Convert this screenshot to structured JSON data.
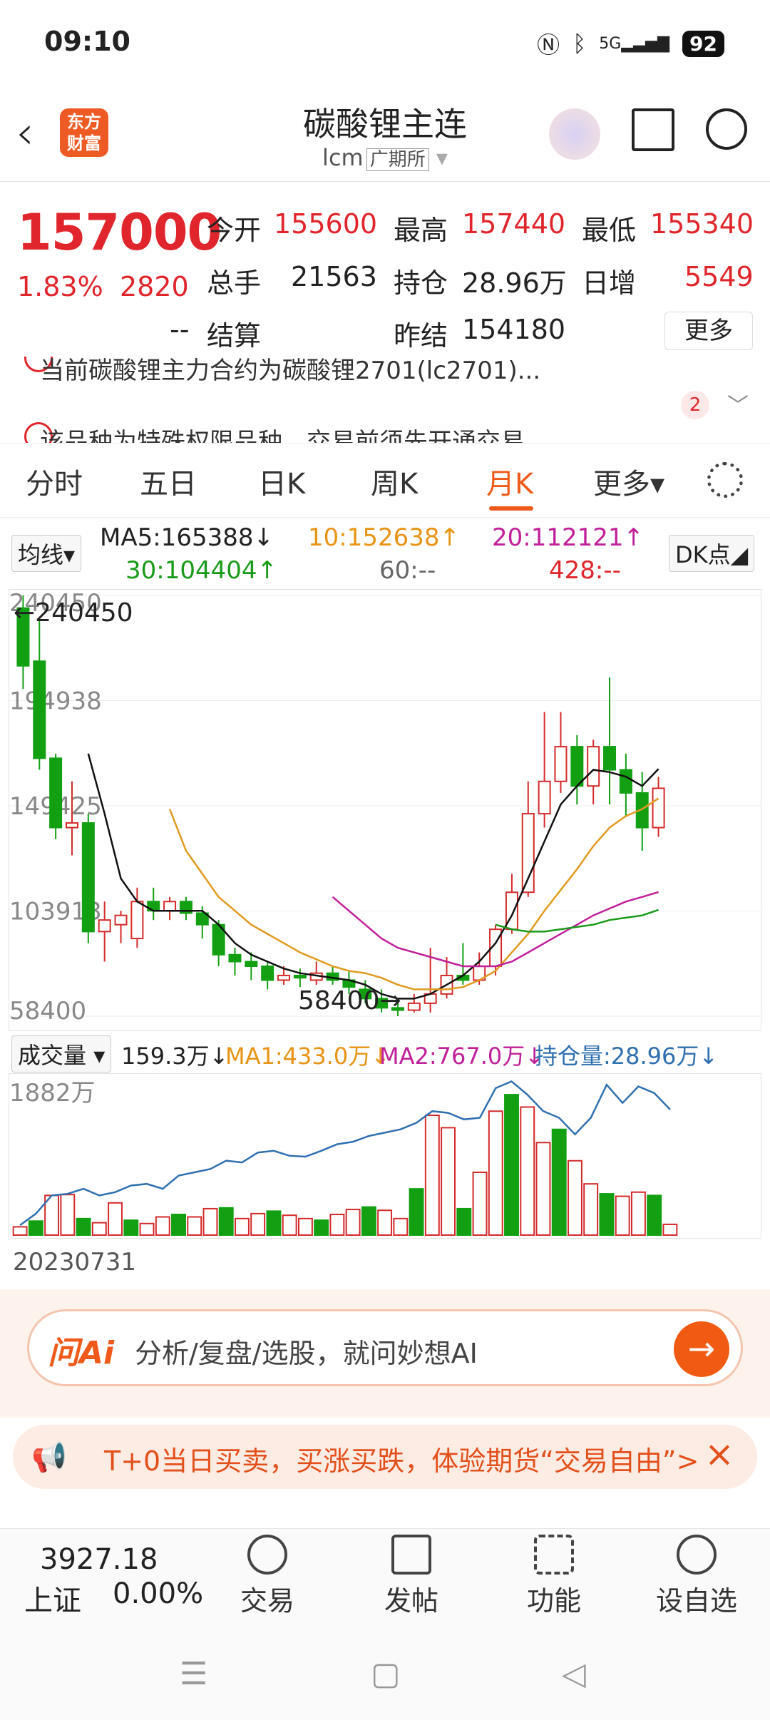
{
  "status": {
    "time": "09:10",
    "network": "5G",
    "battery": "92"
  },
  "header": {
    "logo": "东方\n财富",
    "title": "碳酸锂主连",
    "code": "lcm",
    "exchange": "广期所"
  },
  "quote": {
    "price": "157000",
    "pct": "1.83%",
    "chg": "2820",
    "rows": [
      [
        {
          "k": "今开",
          "v": "155600",
          "c": "red"
        },
        {
          "k": "最高",
          "v": "157440",
          "c": "red"
        },
        {
          "k": "最低",
          "v": "155340",
          "c": "red"
        }
      ],
      [
        {
          "k": "总手",
          "v": "21563",
          "c": "dk"
        },
        {
          "k": "持仓",
          "v": "28.96万",
          "c": "dk"
        },
        {
          "k": "日增",
          "v": "5549",
          "c": "red"
        }
      ],
      [
        {
          "k": "结算",
          "v": "--",
          "c": "dk"
        },
        {
          "k": "昨结",
          "v": "154180",
          "c": "dk"
        }
      ]
    ],
    "more": "更多"
  },
  "notice": {
    "line1": "当前碳酸锂主力合约为碳酸锂2701(lc2701)...",
    "line2": "该品种为特殊权限品种，交易前须先开通交易",
    "count": "2"
  },
  "tabs": [
    "分时",
    "五日",
    "日K",
    "周K",
    "月K",
    "更多▾"
  ],
  "ma": {
    "selector": "均线",
    "ma5": "MA5:165388↓",
    "ma10": "10:152638↑",
    "ma20": "20:112121↑",
    "ma30": "30:104404↑",
    "ma60": "60:--",
    "ma428": "428:--",
    "dk": "DK点"
  },
  "chart_data": {
    "type": "candlestick",
    "y_ticks": [
      "240450",
      "194938",
      "149425",
      "103913",
      "58400"
    ],
    "ylim": [
      58400,
      240450
    ],
    "high_label": "240450",
    "low_label": "58400",
    "candles": [
      [
        235000,
        210000,
        240450,
        200000
      ],
      [
        212000,
        170000,
        230000,
        165000
      ],
      [
        170000,
        140000,
        172000,
        135000
      ],
      [
        140000,
        142000,
        160000,
        128000
      ],
      [
        142000,
        95000,
        146000,
        90000
      ],
      [
        95000,
        100000,
        108000,
        82000
      ],
      [
        98000,
        102000,
        104000,
        90000
      ],
      [
        92000,
        108000,
        114000,
        88000
      ],
      [
        108000,
        104000,
        114000,
        100000
      ],
      [
        104000,
        108000,
        110000,
        100000
      ],
      [
        108000,
        103000,
        110000,
        100000
      ],
      [
        103000,
        98000,
        106000,
        92000
      ],
      [
        98000,
        85000,
        100000,
        80000
      ],
      [
        85000,
        82000,
        88000,
        76000
      ],
      [
        82000,
        80000,
        86000,
        74000
      ],
      [
        80000,
        74000,
        82000,
        70000
      ],
      [
        74000,
        76000,
        80000,
        72000
      ],
      [
        76000,
        75000,
        79000,
        71000
      ],
      [
        74000,
        77000,
        82000,
        72000
      ],
      [
        77000,
        74000,
        80000,
        72000
      ],
      [
        74000,
        71000,
        78000,
        68000
      ],
      [
        70000,
        66000,
        74000,
        64000
      ],
      [
        66000,
        62000,
        70000,
        60000
      ],
      [
        62000,
        61000,
        66000,
        58400
      ],
      [
        61000,
        64000,
        68000,
        60000
      ],
      [
        64000,
        68000,
        88000,
        60000
      ],
      [
        68000,
        76000,
        84000,
        66000
      ],
      [
        76000,
        74000,
        90000,
        72000
      ],
      [
        74000,
        80000,
        86000,
        72000
      ],
      [
        80000,
        96000,
        98000,
        76000
      ],
      [
        96000,
        112000,
        120000,
        94000
      ],
      [
        112000,
        146000,
        160000,
        110000
      ],
      [
        146000,
        160000,
        190000,
        140000
      ],
      [
        160000,
        175000,
        190000,
        155000
      ],
      [
        175000,
        158000,
        180000,
        150000
      ],
      [
        158000,
        175000,
        178000,
        150000
      ],
      [
        175000,
        165000,
        205000,
        150000
      ],
      [
        165000,
        155000,
        172000,
        145000
      ],
      [
        155000,
        140000,
        164000,
        130000
      ],
      [
        140000,
        157000,
        162000,
        136000
      ]
    ],
    "ma5": [
      null,
      null,
      null,
      null,
      172000,
      146000,
      118000,
      108000,
      104000,
      104000,
      104000,
      104000,
      98000,
      90000,
      85000,
      82000,
      79000,
      77000,
      76000,
      75000,
      74000,
      72000,
      68000,
      66000,
      66000,
      68000,
      72000,
      76000,
      82000,
      90000,
      102000,
      118000,
      134000,
      150000,
      158000,
      165000,
      164000,
      162000,
      158000,
      165388
    ],
    "ma10": [
      null,
      null,
      null,
      null,
      null,
      null,
      null,
      null,
      null,
      148000,
      130000,
      120000,
      110000,
      104000,
      98000,
      94000,
      90000,
      86000,
      83000,
      80000,
      78000,
      77000,
      75000,
      72000,
      70000,
      70000,
      70000,
      71000,
      74000,
      78000,
      86000,
      94000,
      104000,
      113000,
      122000,
      132000,
      140000,
      145000,
      148000,
      152638
    ],
    "ma20": [
      null,
      null,
      null,
      null,
      null,
      null,
      null,
      null,
      null,
      null,
      null,
      null,
      null,
      null,
      null,
      null,
      null,
      null,
      null,
      110000,
      104000,
      98000,
      92000,
      88000,
      86000,
      84000,
      82000,
      80000,
      80000,
      80000,
      82000,
      86000,
      90000,
      94000,
      98000,
      102000,
      105000,
      108000,
      110000,
      112121
    ],
    "ma30": [
      null,
      null,
      null,
      null,
      null,
      null,
      null,
      null,
      null,
      null,
      null,
      null,
      null,
      null,
      null,
      null,
      null,
      null,
      null,
      null,
      null,
      null,
      null,
      null,
      null,
      null,
      null,
      null,
      null,
      98000,
      96000,
      95000,
      95000,
      96000,
      97000,
      98000,
      100000,
      101000,
      102000,
      104404
    ]
  },
  "vol": {
    "selector": "成交量",
    "v": "159.3万↓",
    "ma1": "MA1:433.0万↓",
    "ma2": "MA2:767.0万↓",
    "oi": "持仓量:28.96万↓",
    "top": "1882万",
    "date": "20230731",
    "values": [
      100,
      170,
      480,
      490,
      200,
      150,
      390,
      180,
      140,
      220,
      250,
      220,
      320,
      330,
      200,
      260,
      290,
      240,
      200,
      180,
      250,
      310,
      340,
      300,
      200,
      560,
      1450,
      1300,
      320,
      760,
      1500,
      1700,
      1550,
      1120,
      1280,
      900,
      620,
      500,
      470,
      520,
      480,
      130
    ],
    "oi_line": [
      120,
      260,
      480,
      500,
      560,
      480,
      520,
      600,
      620,
      560,
      720,
      760,
      800,
      900,
      880,
      1000,
      1020,
      960,
      950,
      1020,
      1100,
      1130,
      1200,
      1240,
      1280,
      1360,
      1500,
      1480,
      1400,
      1420,
      1780,
      1860,
      1700,
      1500,
      1420,
      1220,
      1420,
      1820,
      1600,
      1800,
      1720,
      1520
    ]
  },
  "ai": {
    "label": "问Ai",
    "text": "分析/复盘/选股，就问妙想AI",
    "go": "→"
  },
  "ad": {
    "text": "T+0当日买卖，买涨买跌，体验期货“交易自由”>"
  },
  "bottom": {
    "index": "3927.18",
    "index_name": "上证",
    "index_pct": "0.00%",
    "items": [
      "交易",
      "发帖",
      "功能",
      "设自选"
    ]
  }
}
